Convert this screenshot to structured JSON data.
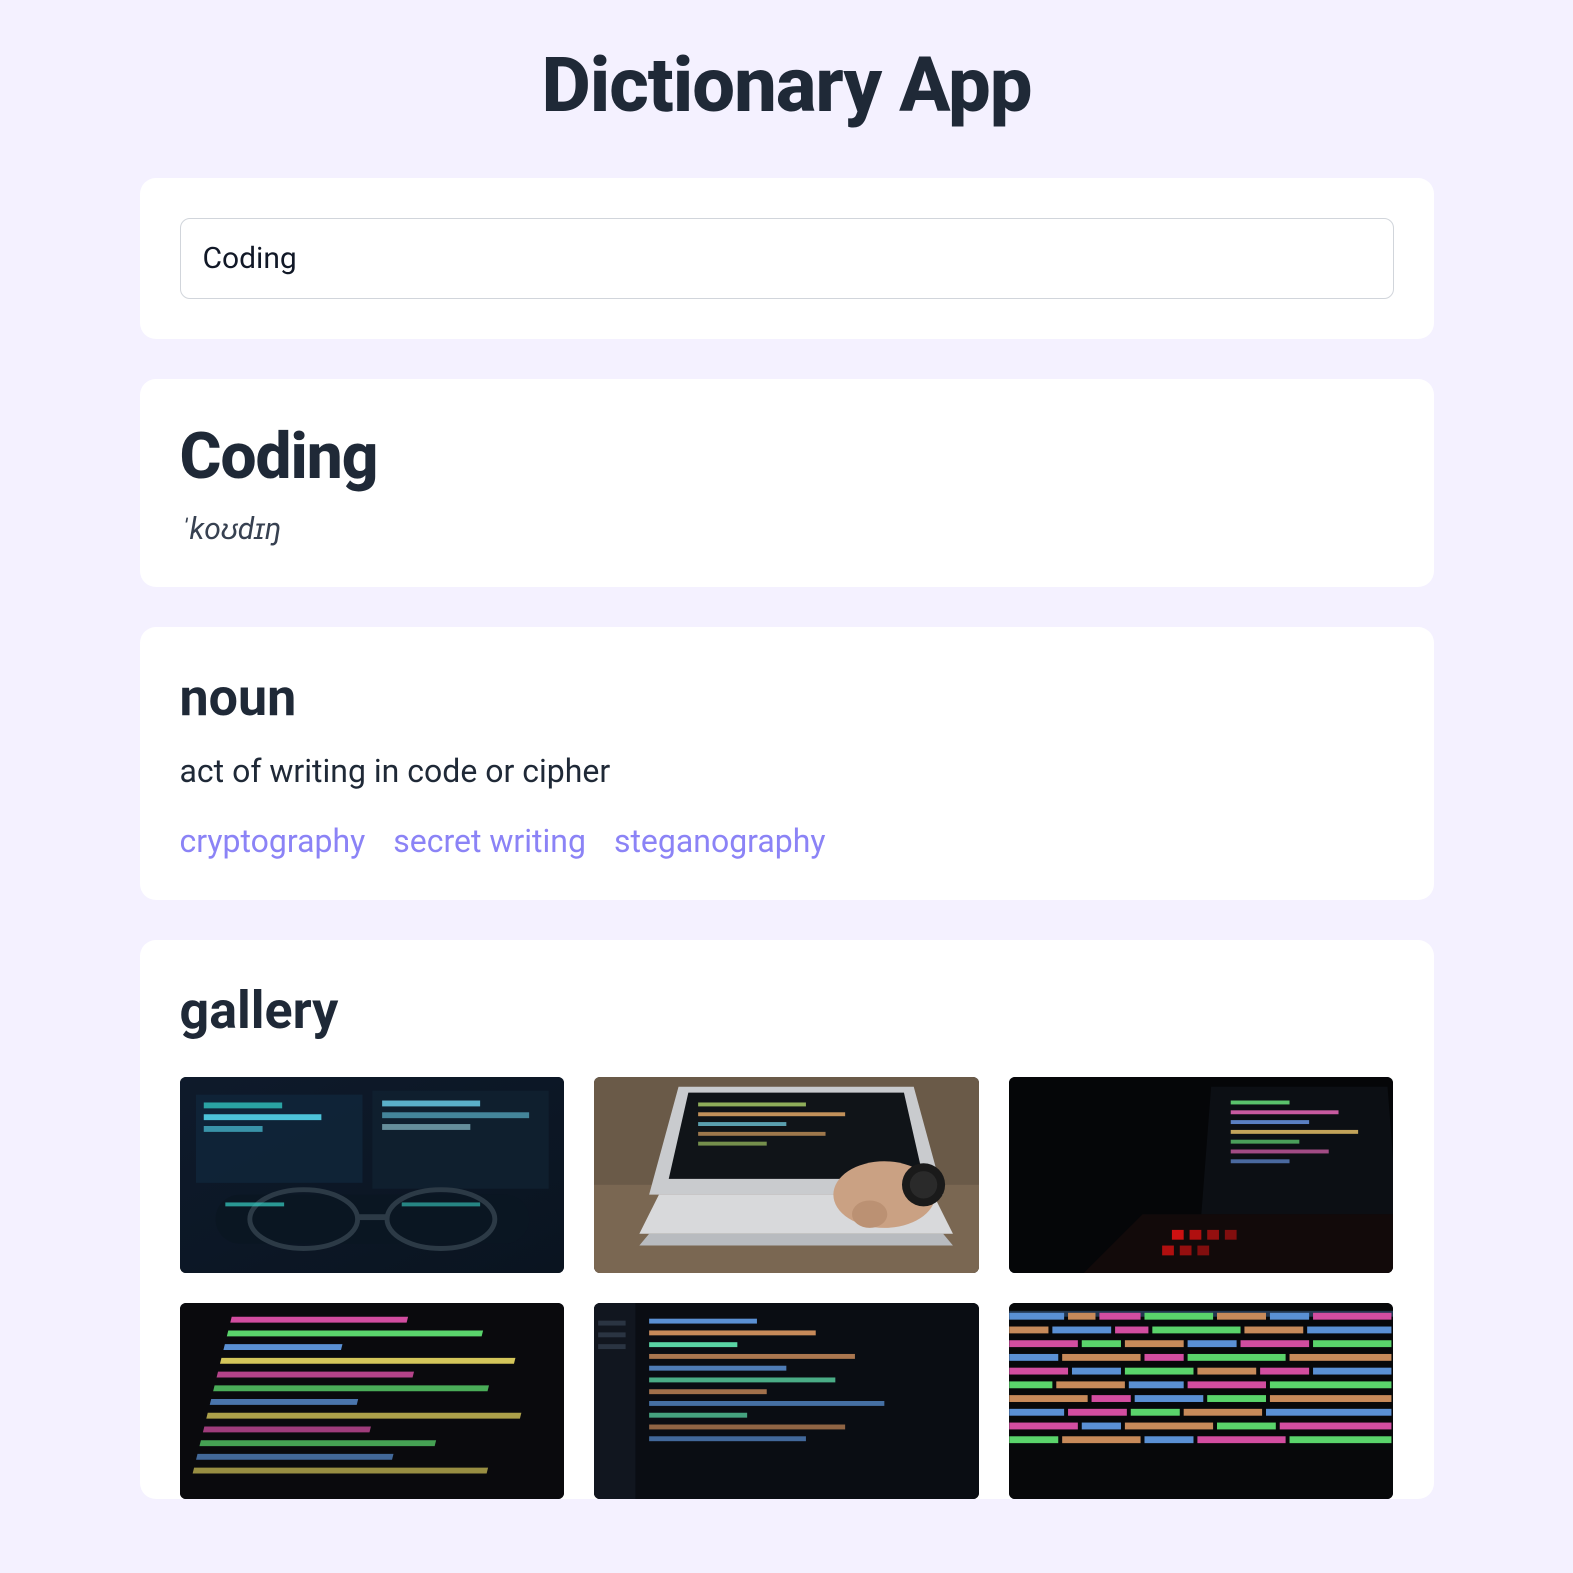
{
  "app": {
    "title": "Dictionary App"
  },
  "search": {
    "value": "Coding",
    "placeholder": "Search a word"
  },
  "entry": {
    "word": "Coding",
    "pronunciation": "ˈkoʊdɪŋ",
    "part_of_speech": "noun",
    "definition": "act of writing in code or cipher",
    "synonyms": [
      "cryptography",
      "secret writing",
      "steganography"
    ]
  },
  "gallery": {
    "title": "gallery",
    "images": [
      {
        "alt": "glasses-on-desk-screens"
      },
      {
        "alt": "hand-typing-laptop"
      },
      {
        "alt": "laptop-code-dark"
      },
      {
        "alt": "colorful-html-code"
      },
      {
        "alt": "editor-dark-code"
      },
      {
        "alt": "dense-js-code"
      }
    ]
  }
}
